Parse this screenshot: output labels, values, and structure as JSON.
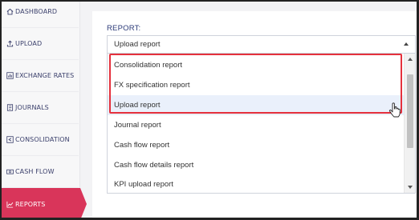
{
  "sidebar": {
    "items": [
      {
        "label": "DASHBOARD",
        "icon": "home-icon"
      },
      {
        "label": "UPLOAD",
        "icon": "upload-icon"
      },
      {
        "label": "EXCHANGE RATES",
        "icon": "bar-chart-icon"
      },
      {
        "label": "JOURNALS",
        "icon": "journal-icon"
      },
      {
        "label": "CONSOLIDATION",
        "icon": "consolidation-icon"
      },
      {
        "label": "CASH FLOW",
        "icon": "cash-icon"
      },
      {
        "label": "REPORTS",
        "icon": "line-chart-icon",
        "active": true
      }
    ]
  },
  "main": {
    "label": "REPORT:",
    "select": {
      "value": "Upload report"
    },
    "options": [
      "Consolidation report",
      "FX specification report",
      "Upload report",
      "Journal report",
      "Cash flow report",
      "Cash flow details report",
      "KPI upload report"
    ],
    "hovered_option": "Upload report"
  },
  "colors": {
    "accent": "#d9355a",
    "highlight_border": "#e5313d",
    "label": "#2b3a78"
  }
}
